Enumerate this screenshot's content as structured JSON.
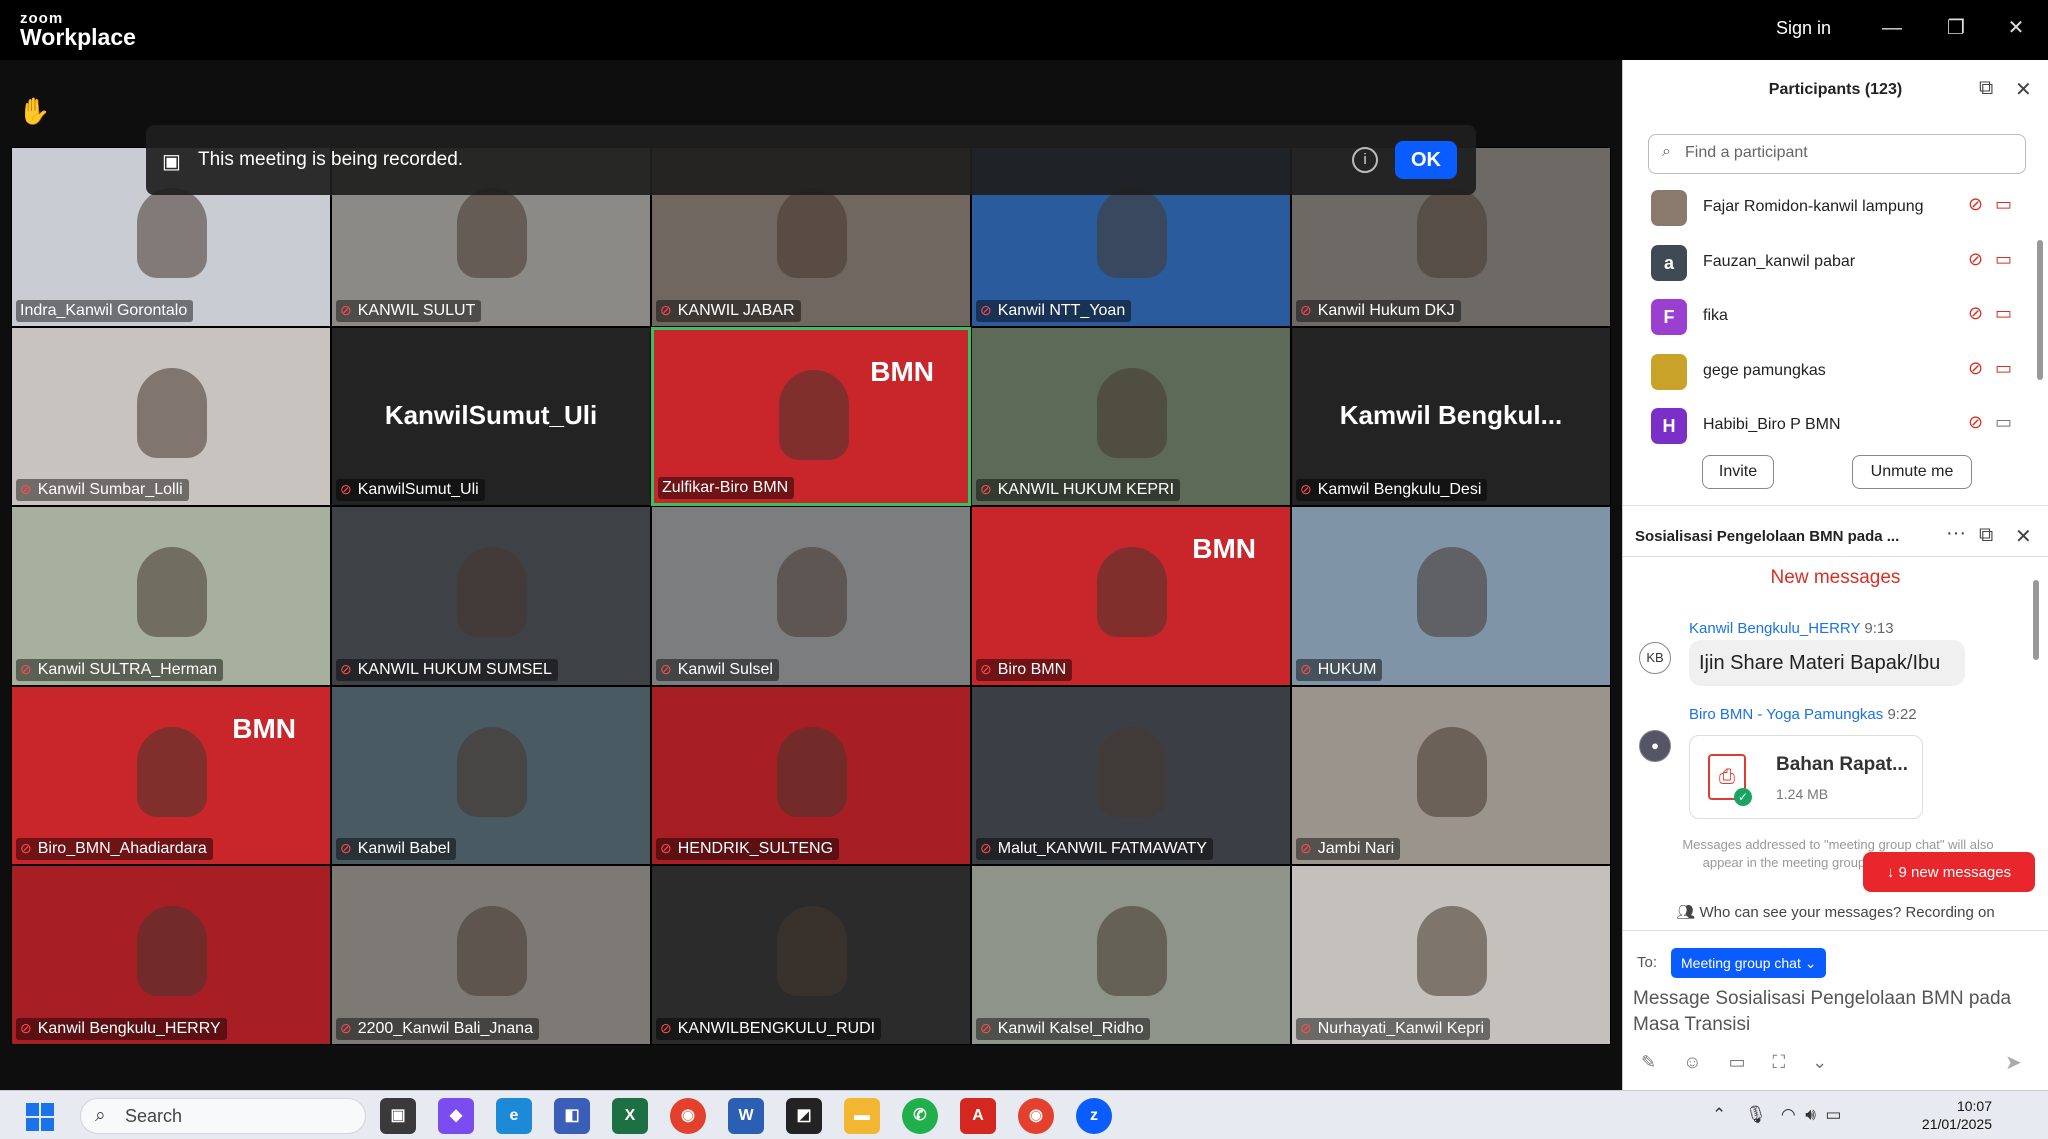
{
  "app": {
    "logo_top": "zoom",
    "logo_bottom": "Workplace",
    "sign_in": "Sign in",
    "minimize": "—",
    "restore": "❐",
    "close": "✕"
  },
  "banner": {
    "message": "This meeting is being recorded.",
    "info": "i",
    "ok": "OK"
  },
  "tiles": [
    {
      "name": "Indra_Kanwil Gorontalo",
      "bg": "#c9ccd2",
      "muted": false
    },
    {
      "name": "KANWIL SULUT",
      "bg": "#8c8a86",
      "muted": true
    },
    {
      "name": "KANWIL JABAR",
      "bg": "#6f6760",
      "muted": true
    },
    {
      "name": "Kanwil NTT_Yoan",
      "bg": "#2a5b9c",
      "muted": true
    },
    {
      "name": "Kanwil Hukum DKJ",
      "bg": "#6d6a66",
      "muted": true
    },
    {
      "name": "Kanwil Sumbar_Lolli",
      "bg": "#c8c3be",
      "muted": true
    },
    {
      "name": "KanwilSumut_Uli",
      "bg": "#232323",
      "muted": true,
      "big": "KanwilSumut_Uli"
    },
    {
      "name": "Zulfikar-Biro BMN",
      "bg": "#c8262b",
      "muted": false,
      "brand": "BMN",
      "active": true
    },
    {
      "name": "KANWIL HUKUM KEPRI",
      "bg": "#5d6a57",
      "muted": true
    },
    {
      "name": "Kamwil Bengkulu_Desi",
      "bg": "#232323",
      "muted": true,
      "big": "Kamwil  Bengkul..."
    },
    {
      "name": "Kanwil SULTRA_Herman",
      "bg": "#a7b09c",
      "muted": true
    },
    {
      "name": "KANWIL HUKUM SUMSEL",
      "bg": "#3e4247",
      "muted": true
    },
    {
      "name": "Kanwil Sulsel",
      "bg": "#7b7d7f",
      "muted": true
    },
    {
      "name": "Biro BMN",
      "bg": "#c8262b",
      "muted": true,
      "brand": "BMN"
    },
    {
      "name": "HUKUM",
      "bg": "#7f94a6",
      "muted": true
    },
    {
      "name": "Biro_BMN_Ahadiardara",
      "bg": "#c8262b",
      "muted": true,
      "brand": "BMN"
    },
    {
      "name": "Kanwil Babel",
      "bg": "#4a5a63",
      "muted": true
    },
    {
      "name": "HENDRIK_SULTENG",
      "bg": "#a81e25",
      "muted": true
    },
    {
      "name": "Malut_KANWIL FATMAWATY",
      "bg": "#3b3f45",
      "muted": true
    },
    {
      "name": "Jambi Nari",
      "bg": "#9b948c",
      "muted": true
    },
    {
      "name": "Kanwil Bengkulu_HERRY",
      "bg": "#a81e25",
      "muted": true
    },
    {
      "name": "2200_Kanwil Bali_Jnana",
      "bg": "#7d7a76",
      "muted": true
    },
    {
      "name": "KANWILBENGKULU_RUDI",
      "bg": "#2b2b2b",
      "muted": true
    },
    {
      "name": "Kanwil Kalsel_Ridho",
      "bg": "#8e9489",
      "muted": true
    },
    {
      "name": "Nurhayati_Kanwil Kepri",
      "bg": "#c4c0bb",
      "muted": true
    }
  ],
  "participants": {
    "title": "Participants (123)",
    "search_placeholder": "Find a participant",
    "list": [
      {
        "name": "Fajar Romidon-kanwil lampung",
        "initial": "",
        "color": "#8a7a6e"
      },
      {
        "name": "Fauzan_kanwil pabar",
        "initial": "a",
        "color": "#3f4a55"
      },
      {
        "name": "fika",
        "initial": "F",
        "color": "#9b3fd1"
      },
      {
        "name": "gege pamungkas",
        "initial": "",
        "color": "#c9a22a"
      },
      {
        "name": "Habibi_Biro P BMN",
        "initial": "H",
        "color": "#7b2fc9"
      }
    ],
    "invite": "Invite",
    "unmute": "Unmute me"
  },
  "chat": {
    "title": "Sosialisasi Pengelolaan BMN pada ...",
    "more": "···",
    "new_messages": "New messages",
    "msg1": {
      "sender": "Kanwil Bengkulu_HERRY",
      "time": "9:13",
      "avatar": "KB",
      "text": "Ijin Share  Materi Bapak/Ibu"
    },
    "msg2": {
      "sender": "Biro BMN - Yoga Pamungkas",
      "time": "9:22",
      "file_name": "Bahan Rapat...",
      "file_size": "1.24 MB"
    },
    "note": "Messages addressed to \"meeting group chat\" will also appear in the meeting group chat in Team Chat",
    "new_pill": "↓  9 new messages",
    "privacy": "Who can see your messages? Recording on",
    "to_label": "To:",
    "recipient": "Meeting group chat ⌄",
    "compose_placeholder": "Message Sosialisasi Pengelolaan BMN pada Masa Transisi"
  },
  "taskbar": {
    "search": "Search",
    "time": "10:07",
    "date": "21/01/2025"
  }
}
